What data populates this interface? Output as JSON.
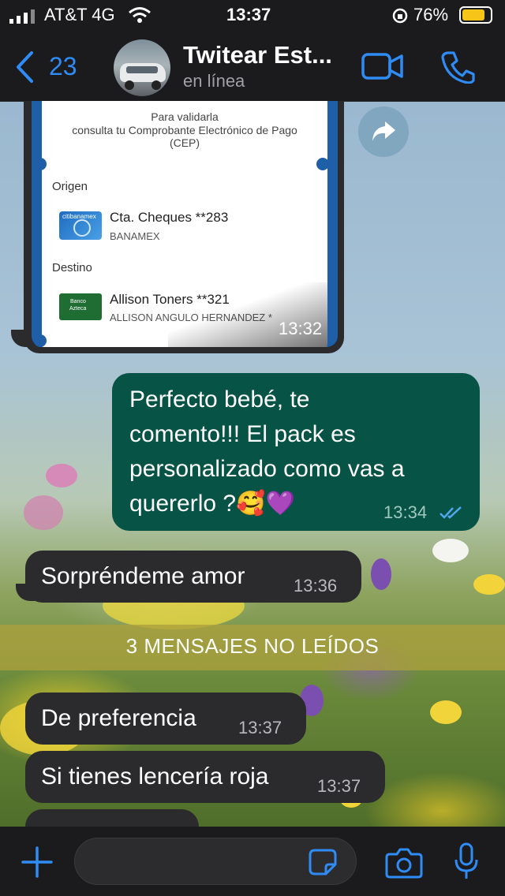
{
  "status_bar": {
    "carrier": "AT&T 4G",
    "time": "13:37",
    "battery": "76%"
  },
  "header": {
    "back_count": "23",
    "contact_name": "Twitear Est...",
    "presence": "en línea"
  },
  "icons": {
    "back": "chevron-left-icon",
    "video": "video-camera-icon",
    "call": "phone-icon",
    "forward": "forward-arrow-icon",
    "add": "plus-icon",
    "sticker": "sticker-icon",
    "camera": "camera-icon",
    "mic": "microphone-icon"
  },
  "receipt": {
    "validate_line1": "Para validarla",
    "validate_line2": "consulta tu Comprobante Electrónico de Pago",
    "validate_line3": "(CEP)",
    "origin_label": "Origen",
    "origin_account": "Cta. Cheques **283",
    "origin_bank": "BANAMEX",
    "origin_card_text": "citibanamex",
    "dest_label": "Destino",
    "dest_account": "Allison Toners **321",
    "dest_name": "ALLISON ANGULO HERNANDEZ *",
    "dest_card_text_1": "Banco",
    "dest_card_text_2": "Azteca",
    "time": "13:32"
  },
  "messages": [
    {
      "direction": "out",
      "lines": [
        "Perfecto bebé, te",
        "comento!!! El pack es",
        "personalizado como vas a",
        "quererlo ?🥰💜"
      ],
      "time": "13:34",
      "status": "read"
    },
    {
      "direction": "in",
      "text": "Sorpréndeme amor",
      "time": "13:36"
    },
    {
      "direction": "in",
      "text": "De preferencia",
      "time": "13:37"
    },
    {
      "direction": "in",
      "text": "Si tienes lencería roja",
      "time": "13:37"
    }
  ],
  "unread_divider": "3 MENSAJES NO LEÍDOS",
  "colors": {
    "accent": "#2f8cf5",
    "outgoing_bubble": "#075346",
    "incoming_bubble": "#2b2b2e",
    "bar_background": "#1b1b1d",
    "battery_fill": "#f5c518"
  }
}
